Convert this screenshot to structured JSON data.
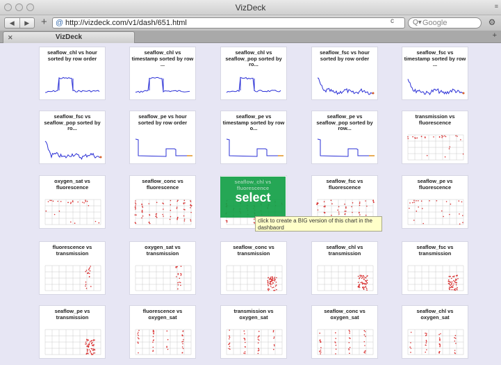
{
  "window": {
    "title": "VizDeck"
  },
  "toolbar": {
    "back_icon": "back-arrow-icon",
    "forward_icon": "forward-arrow-icon",
    "url": "http://vizdeck.com/v1/dash/651.html",
    "search_placeholder": "Google"
  },
  "tabs": [
    {
      "label": "VizDeck"
    }
  ],
  "colors": {
    "line": "#2a2fd6",
    "scatter": "#d92c2c",
    "grid": "#c9c9c9",
    "select": "#14a048",
    "tooltip_bg": "#ffffc9"
  },
  "cards": [
    {
      "title": "seaflow_chl vs hour sorted by row order",
      "type": "line-step"
    },
    {
      "title": "seaflow_chl vs timestamp sorted by row ...",
      "type": "line-step"
    },
    {
      "title": "seaflow_chl vs seaflow_pop sorted by ro...",
      "type": "line-step"
    },
    {
      "title": "seaflow_fsc vs hour sorted by row order",
      "type": "line-noisy"
    },
    {
      "title": "seaflow_fsc vs timestamp sorted by row ...",
      "type": "line-noisy"
    },
    {
      "title": "seaflow_fsc vs seaflow_pop sorted by ro...",
      "type": "line-noisy"
    },
    {
      "title": "seaflow_pe vs hour sorted by row order",
      "type": "line-drop"
    },
    {
      "title": "seaflow_pe vs timestamp sorted by row o...",
      "type": "line-drop"
    },
    {
      "title": "seaflow_pe vs seaflow_pop sorted by row...",
      "type": "line-drop"
    },
    {
      "title": "transmission vs fluorescence",
      "type": "scatter-sparse"
    },
    {
      "title": "oxygen_sat vs fluorescence",
      "type": "scatter-sparse"
    },
    {
      "title": "seaflow_conc vs fluorescence",
      "type": "scatter-dense"
    },
    {
      "title": "seaflow_chl vs fluorescence",
      "type": "scatter-dense"
    },
    {
      "title": "seaflow_fsc vs fluorescence",
      "type": "scatter-dense"
    },
    {
      "title": "seaflow_pe vs fluorescence",
      "type": "scatter-sparse"
    },
    {
      "title": "fluorescence vs transmission",
      "type": "scatter-right"
    },
    {
      "title": "oxygen_sat vs transmission",
      "type": "scatter-right"
    },
    {
      "title": "seaflow_conc vs transmission",
      "type": "scatter-cluster"
    },
    {
      "title": "seaflow_chl vs transmission",
      "type": "scatter-cluster"
    },
    {
      "title": "seaflow_fsc vs transmission",
      "type": "scatter-cluster"
    },
    {
      "title": "seaflow_pe vs transmission",
      "type": "scatter-cluster"
    },
    {
      "title": "fluorescence vs oxygen_sat",
      "type": "scatter-vertical"
    },
    {
      "title": "transmission vs oxygen_sat",
      "type": "scatter-vertical"
    },
    {
      "title": "seaflow_conc vs oxygen_sat",
      "type": "scatter-vertical"
    },
    {
      "title": "seaflow_chl vs oxygen_sat",
      "type": "scatter-vertical"
    }
  ],
  "overlay": {
    "label": "select"
  },
  "tooltip": {
    "text": "click to create a BIG version of this chart in the dashbaord"
  }
}
